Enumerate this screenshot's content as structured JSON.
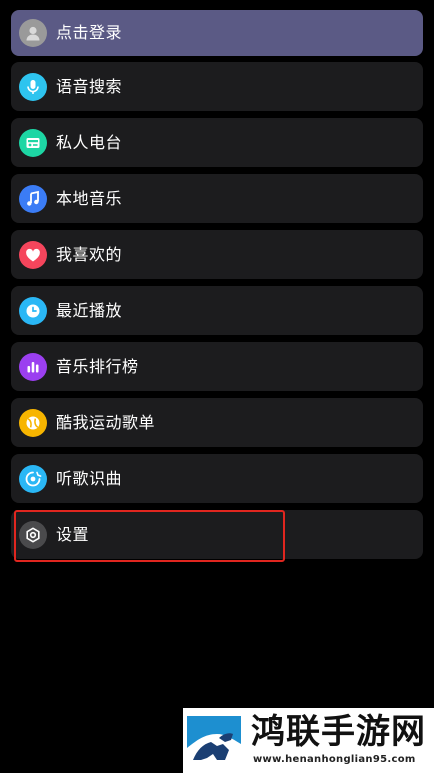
{
  "menu": {
    "login": {
      "label": "点击登录",
      "icon": "avatar-icon",
      "color": "#9a9a9a"
    },
    "items": [
      {
        "label": "语音搜索",
        "icon": "microphone-icon",
        "color": "#2ec4ef"
      },
      {
        "label": "私人电台",
        "icon": "radio-icon",
        "color": "#1dd6a4"
      },
      {
        "label": "本地音乐",
        "icon": "music-note-icon",
        "color": "#3b7cf5"
      },
      {
        "label": "我喜欢的",
        "icon": "heart-icon",
        "color": "#f5455c"
      },
      {
        "label": "最近播放",
        "icon": "clock-icon",
        "color": "#2ab7f5"
      },
      {
        "label": "音乐排行榜",
        "icon": "bar-chart-icon",
        "color": "#9b3ff0"
      },
      {
        "label": "酷我运动歌单",
        "icon": "sports-ball-icon",
        "color": "#f7b500"
      },
      {
        "label": "听歌识曲",
        "icon": "music-recognition-icon",
        "color": "#2ab7f5"
      },
      {
        "label": "设置",
        "icon": "settings-hexagon-icon",
        "color": "#4a4a4c"
      }
    ]
  },
  "annotation": {
    "highlight_color": "#e0261f"
  },
  "watermark": {
    "title": "鸿联手游网",
    "url": "www.henanhonglian95.com"
  }
}
